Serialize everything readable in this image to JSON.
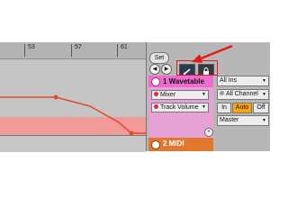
{
  "ruler": {
    "bars": [
      "53",
      "57",
      "61"
    ]
  },
  "controls": {
    "set_label": "Set",
    "nav_left": "◀",
    "nav_right": "▶",
    "draw_icon": "pencil-icon",
    "lock_icon": "lock-icon"
  },
  "track1": {
    "name": "1 Wavetable",
    "color": "#f06ad1",
    "device_chooser": "Mixer",
    "parameter_chooser": "Track Volume",
    "plus_label": "+"
  },
  "track2": {
    "name": "2 MIDI",
    "color": "#e1782d"
  },
  "io": {
    "input_type": "All Ins",
    "input_channel": "All Channel",
    "monitor": {
      "in": "In",
      "auto": "Auto",
      "off": "Off"
    },
    "output": "Master"
  },
  "annotation": {
    "color": "#e21c1c"
  }
}
